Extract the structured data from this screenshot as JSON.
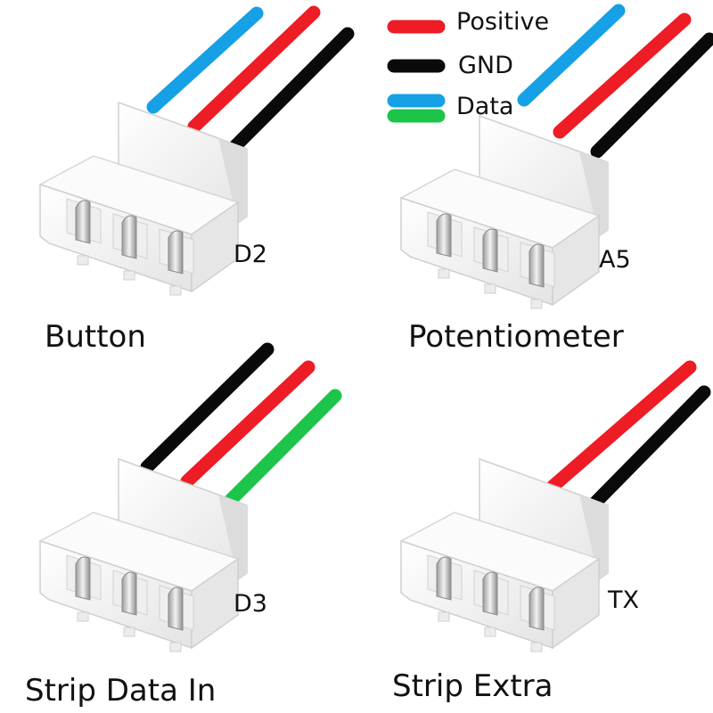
{
  "colors": {
    "positive": "#ee1c24",
    "gnd": "#0a0a0a",
    "data_blue": "#16a0e6",
    "data_green": "#1dc44a",
    "housing": "#f7f7f7",
    "housing_shade": "#e2e2e2",
    "pin_metal": "#c9c9c9"
  },
  "legend": {
    "positive": "Positive",
    "gnd": "GND",
    "data": "Data"
  },
  "connectors": [
    {
      "title": "Button",
      "pin": "D2",
      "wires": [
        "data_blue",
        "positive",
        "gnd"
      ]
    },
    {
      "title": "Potentiometer",
      "pin": "A5",
      "wires": [
        "data_blue",
        "positive",
        "gnd"
      ]
    },
    {
      "title": "Strip Data In",
      "pin": "D3",
      "wires": [
        "gnd",
        "positive",
        "data_green"
      ]
    },
    {
      "title": "Strip Extra",
      "pin": "TX",
      "wires": [
        "positive",
        "gnd"
      ]
    }
  ]
}
